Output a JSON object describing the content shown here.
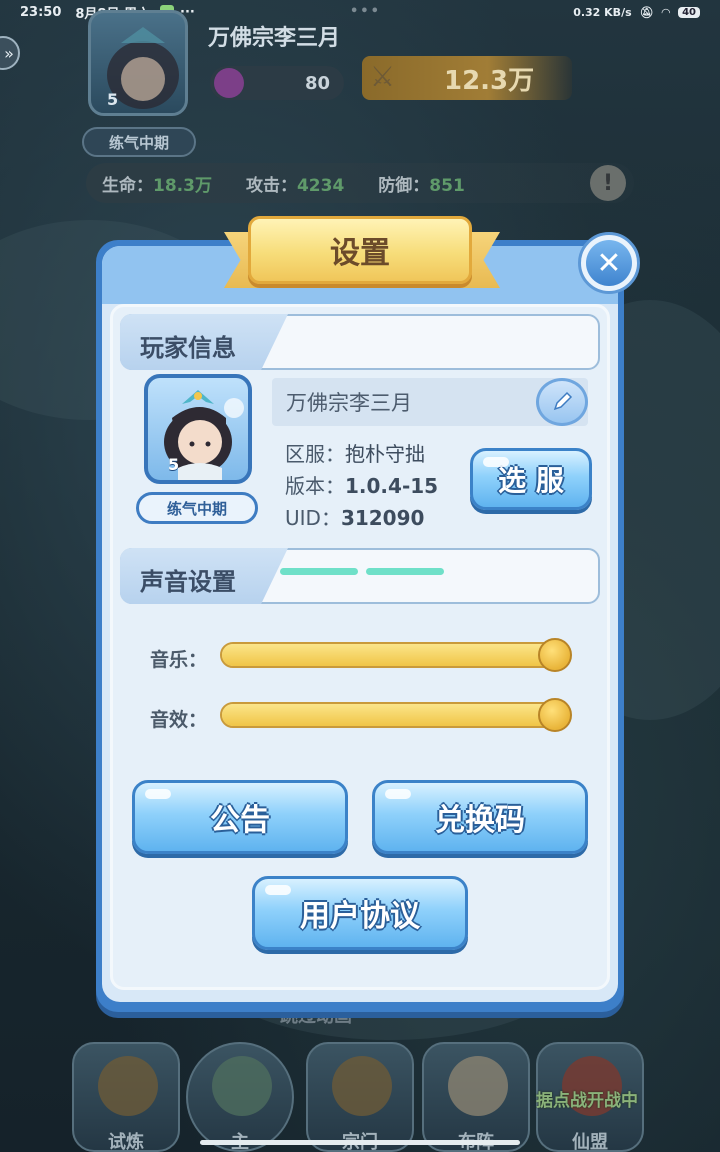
{
  "statusbar": {
    "time": "23:50",
    "date": "8月8日 周六",
    "more": "···",
    "net_speed": "0.32 KB/s",
    "battery": "40"
  },
  "background": {
    "player_name": "万佛宗李三月",
    "level": "5",
    "rank": "练气中期",
    "energy": "80",
    "power": "12.3万",
    "stats": {
      "hp_label": "生命：",
      "hp_value": "18.3万",
      "atk_label": "攻击：",
      "atk_value": "4234",
      "def_label": "防御：",
      "def_value": "851"
    },
    "skip_anim": "跳过动画",
    "nav": [
      {
        "label": "试炼",
        "icon": "trial-icon"
      },
      {
        "label": "主",
        "icon": "main-icon"
      },
      {
        "label": "宗门",
        "icon": "sect-icon"
      },
      {
        "label": "布阵",
        "icon": "formation-icon"
      },
      {
        "label": "仙盟",
        "icon": "alliance-icon"
      }
    ],
    "nav_badge": "据点战开战中"
  },
  "dialog": {
    "title": "设置",
    "close_icon": "close-icon",
    "player_info": {
      "section_title": "玩家信息",
      "level": "5",
      "rank": "练气中期",
      "name": "万佛宗李三月",
      "server_label": "区服：",
      "server_value": "抱朴守拙",
      "version_label": "版本：",
      "version_value": "1.0.4-15",
      "uid_label": "UID：",
      "uid_value": "312090",
      "select_server_button": "选 服"
    },
    "sound": {
      "section_title": "声音设置",
      "music_label": "音乐：",
      "music_level": 1.0,
      "sfx_label": "音效：",
      "sfx_level": 1.0
    },
    "buttons": {
      "notice": "公告",
      "redeem": "兑换码",
      "agreement": "用户协议"
    }
  },
  "colors": {
    "dialog_border": "#3d7fc9",
    "panel": "#e6f0f9",
    "button_blue": "#5fb3ef",
    "title_gold": "#f7dd7a",
    "slider_gold": "#f0c547",
    "accent_teal": "#6fe0c8"
  }
}
